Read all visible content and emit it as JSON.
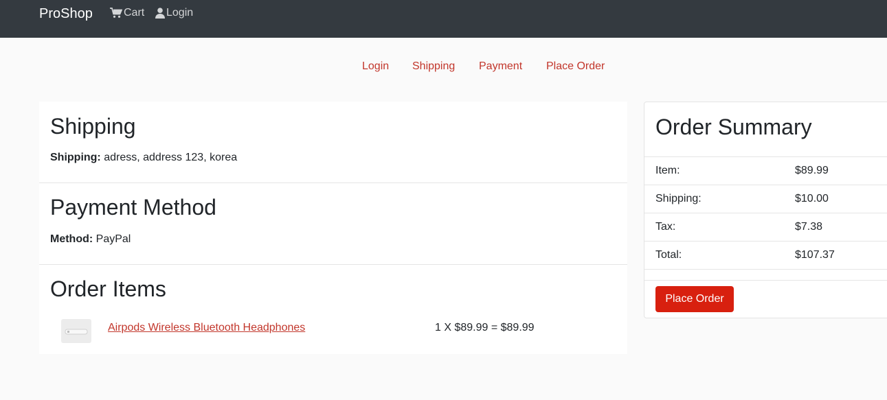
{
  "navbar": {
    "brand": "ProShop",
    "cart_label": "Cart",
    "login_label": "Login",
    "cart_icon": "cart-icon",
    "user_icon": "user-icon"
  },
  "steps": [
    "Login",
    "Shipping",
    "Payment",
    "Place Order"
  ],
  "shipping": {
    "title": "Shipping",
    "label": "Shipping:",
    "value": "adress, address 123, korea"
  },
  "payment": {
    "title": "Payment Method",
    "label": "Method:",
    "value": "PayPal"
  },
  "order_items": {
    "title": "Order Items",
    "items": [
      {
        "name": "Airpods Wireless Bluetooth Headphones",
        "price_line": "1 X $89.99 = $89.99"
      }
    ]
  },
  "summary": {
    "title": "Order Summary",
    "rows": [
      {
        "label": "Item:",
        "value": "$89.99"
      },
      {
        "label": "Shipping:",
        "value": "$10.00"
      },
      {
        "label": "Tax:",
        "value": "$7.38"
      },
      {
        "label": "Total:",
        "value": "$107.37"
      }
    ],
    "button_label": "Place Order"
  },
  "colors": {
    "navbar": "#343a40",
    "accent": "#c2362b",
    "button": "#d8200f"
  }
}
